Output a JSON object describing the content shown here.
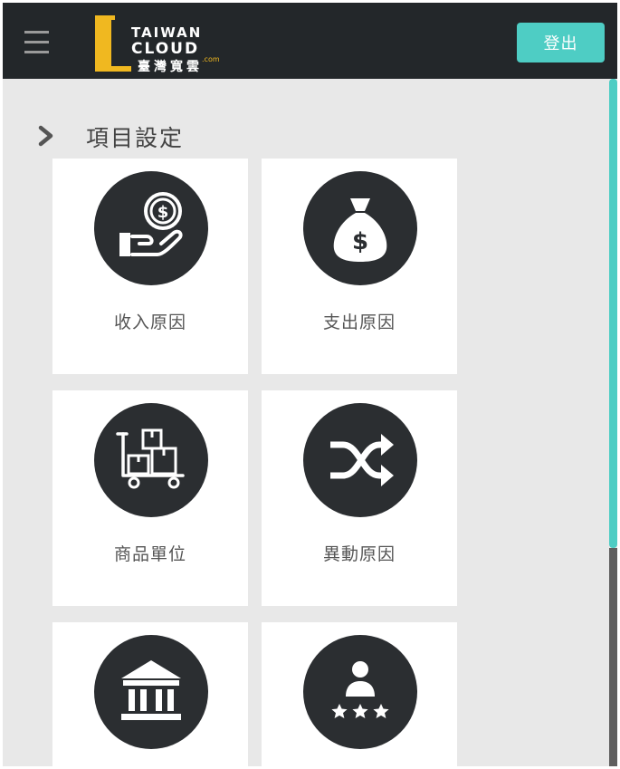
{
  "header": {
    "logo": {
      "line1": "TAIWAN",
      "line2": "CLOUD",
      "suffix": ".com",
      "chinese": "臺灣寬雲"
    },
    "logout_label": "登出",
    "accent_color": "#4ecdc4",
    "menu_icon": "hamburger-menu-icon"
  },
  "section": {
    "title": "項目設定",
    "icon": "chevron-right-icon"
  },
  "cards": [
    {
      "label": "收入原因",
      "icon": "hand-coin-icon"
    },
    {
      "label": "支出原因",
      "icon": "money-bag-icon"
    },
    {
      "label": "商品單位",
      "icon": "cart-boxes-icon"
    },
    {
      "label": "異動原因",
      "icon": "shuffle-icon"
    },
    {
      "label": "",
      "icon": "bank-icon"
    },
    {
      "label": "",
      "icon": "person-stars-icon"
    }
  ]
}
